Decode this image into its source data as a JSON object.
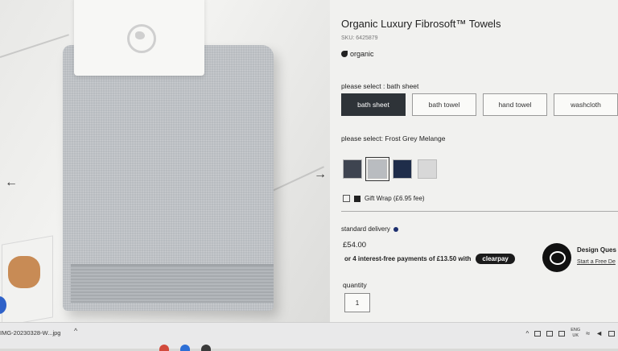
{
  "product": {
    "title": "Organic Luxury Fibrosoft™ Towels",
    "sku": "SKU: 6425879",
    "badge": "organic"
  },
  "size_selector": {
    "label": "please select : bath sheet",
    "options": [
      "bath sheet",
      "bath towel",
      "hand towel",
      "washcloth"
    ],
    "selected": "bath sheet"
  },
  "color_selector": {
    "label": "please select: Frost Grey Melange",
    "swatches": [
      "#3e4450",
      "#b9bcc0",
      "#1f2d4a",
      "#d8d8d8"
    ],
    "selected_index": 1
  },
  "gift_wrap": {
    "label": "Gift Wrap (£6.95 fee)",
    "checked": false
  },
  "delivery": {
    "label": "standard delivery"
  },
  "price": "£54.00",
  "installments": {
    "text": "or 4 interest-free payments of £13.50 with",
    "provider": "clearpay"
  },
  "design_question": {
    "title": "Design Ques",
    "link": "Start a Free De"
  },
  "quantity": {
    "label": "quantity",
    "value": "1"
  },
  "taskbar": {
    "file_name": "IMG-20230328-W...jpg",
    "lang_top": "ENG",
    "lang_bottom": "UK"
  },
  "colors": {
    "primary_button": "#2e3338",
    "clearpay_bg": "#1b1b1b"
  }
}
